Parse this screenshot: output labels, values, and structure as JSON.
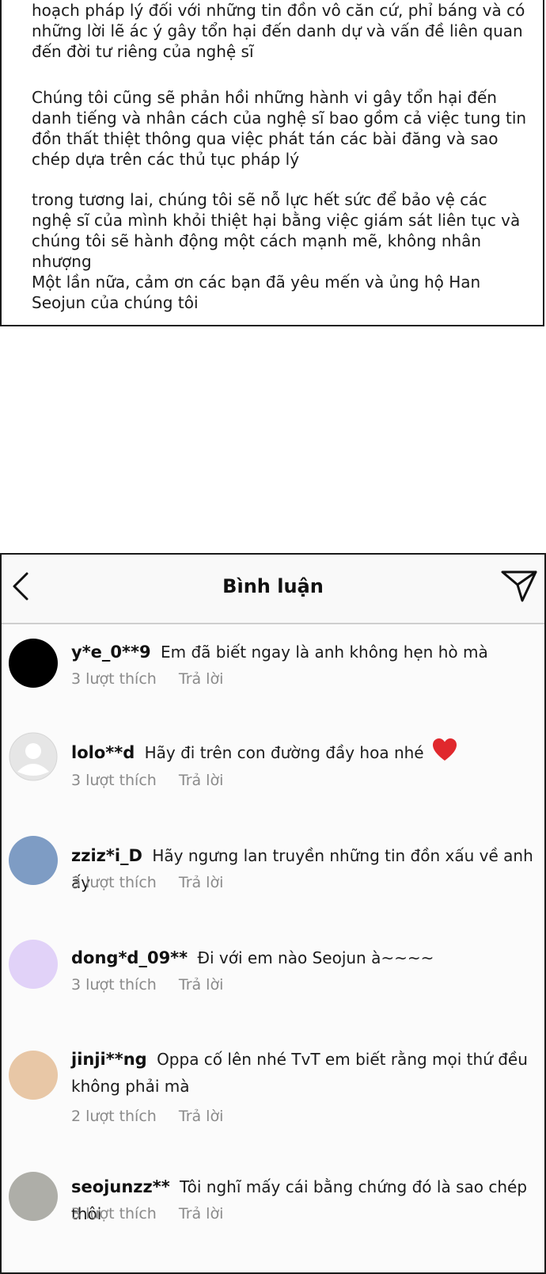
{
  "letter": {
    "paragraphs": [
      "hoạch pháp lý đối với những tin đồn vô căn cứ, phỉ báng và có những lời lẽ ác ý gây tổn hại đến danh dự và vấn đề liên quan đến đời tư riêng của nghệ sĩ",
      "Chúng tôi cũng sẽ phản hồi những hành vi gây tổn hại đến danh tiếng và nhân cách của nghệ sĩ bao gồm cả việc tung tin đồn thất thiệt thông qua việc phát tán các bài đăng và sao chép dựa trên các thủ tục pháp lý",
      "trong tương lai, chúng tôi sẽ nỗ lực hết sức để bảo vệ các nghệ sĩ của mình khỏi thiệt hại bằng việc giám sát liên tục và chúng tôi sẽ hành động một cách mạnh mẽ, không nhân nhượng",
      "Một lần nữa, cảm ơn các bạn đã yêu mến và ủng hộ Han Seojun của chúng tôi"
    ]
  },
  "comments_screen": {
    "title": "Bình luận",
    "back_icon": "chevron-left-icon",
    "send_icon": "paper-plane-icon",
    "comments": [
      {
        "username": "y*e_0**9",
        "text": "Em đã biết ngay là anh không hẹn hò mà",
        "likes": "3 lượt thích",
        "reply": "Trả lời",
        "avatar_color": "#000000"
      },
      {
        "username": "lolo**d",
        "text": "Hãy đi trên con đường đầy hoa nhé",
        "likes": "3 lượt thích",
        "reply": "Trả lời",
        "avatar_color": "#e6e6e6",
        "avatar_type": "default-user-icon",
        "emoji": "red-heart-icon"
      },
      {
        "username": "zziz*i_D",
        "text": "Hãy ngưng lan truyền những tin đồn xấu về anh ấy",
        "likes": "3 lượt thích",
        "reply": "Trả lời",
        "avatar_color": "#7e9cc4"
      },
      {
        "username": "dong*d_09**",
        "text": "Đi với em nào Seojun à~~~~",
        "likes": "3 lượt thích",
        "reply": "Trả lời",
        "avatar_color": "#e1d2f8"
      },
      {
        "username": "jinji**ng",
        "text": "Oppa cố lên nhé TvT em biết rằng mọi thứ đều không phải mà",
        "likes": "2 lượt thích",
        "reply": "Trả lời",
        "avatar_color": "#e8c7a6"
      },
      {
        "username": "seojunzz**",
        "text": "Tôi nghĩ mấy cái bằng chứng đó là sao chép thôi",
        "likes": "3 lượt thích",
        "reply": "Trả lời",
        "avatar_color": "#aeaea8"
      }
    ]
  }
}
